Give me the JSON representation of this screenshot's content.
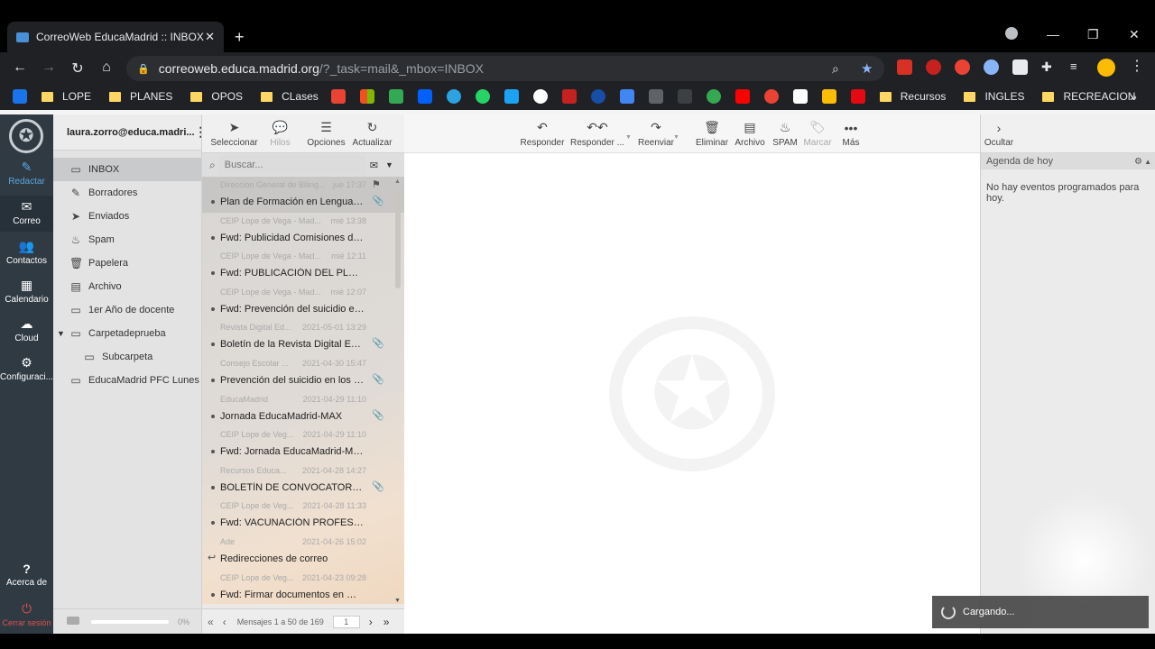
{
  "browser": {
    "tab_title": "CorreoWeb EducaMadrid :: INBOX",
    "url_host": "correoweb.educa.madrid.org",
    "url_path": "/?_task=mail&_mbox=INBOX",
    "bookmarks": [
      "LOPE",
      "PLANES",
      "OPOS",
      "CLases",
      "Recursos",
      "INGLES",
      "RECREACION"
    ],
    "more_bookmarks": "»"
  },
  "leftnav": {
    "compose": "Redactar",
    "mail": "Correo",
    "contacts": "Contactos",
    "calendar": "Calendario",
    "cloud": "Cloud",
    "settings": "Configuraci...",
    "about": "Acerca de",
    "logout": "Cerrar sesión"
  },
  "account": "laura.zorro@educa.madri...",
  "folders": [
    {
      "label": "INBOX",
      "icon": "inbox-icon"
    },
    {
      "label": "Borradores",
      "icon": "pencil-icon"
    },
    {
      "label": "Enviados",
      "icon": "send-icon"
    },
    {
      "label": "Spam",
      "icon": "fire-icon"
    },
    {
      "label": "Papelera",
      "icon": "trash-icon"
    },
    {
      "label": "Archivo",
      "icon": "archive-icon"
    },
    {
      "label": "1er Año de docente",
      "icon": "folder-icon"
    },
    {
      "label": "Carpetadeprueba",
      "icon": "folder-icon"
    },
    {
      "label": "Subcarpeta",
      "icon": "folder-icon"
    },
    {
      "label": "EducaMadrid PFC Lunes",
      "icon": "folder-icon"
    }
  ],
  "quota": "0%",
  "list_toolbar": {
    "select": "Seleccionar",
    "threads": "Hilos",
    "options": "Opciones",
    "refresh": "Actualizar"
  },
  "search_placeholder": "Buscar...",
  "messages": [
    {
      "from": "Dirección General de Biling...",
      "date": "jue 17:37",
      "subject": "Plan de Formación en Lenguas E...",
      "attach": true
    },
    {
      "from": "CEIP Lope de Vega - Mad...",
      "date": "mié 13:38",
      "subject": "Fwd: Publicidad Comisiones de ...",
      "attach": false
    },
    {
      "from": "CEIP Lope de Vega - Mad...",
      "date": "mié 12:11",
      "subject": "Fwd: PUBLICACIÓN DEL PLAN D...",
      "attach": false
    },
    {
      "from": "CEIP Lope de Vega - Mad...",
      "date": "mié 12:07",
      "subject": "Fwd: Prevención del suicidio en l...",
      "attach": false
    },
    {
      "from": "Revista Digital Ed...",
      "date": "2021-05-01 13:29",
      "subject": "Boletín de la Revista Digital Educ...",
      "attach": true
    },
    {
      "from": "Consejo Escolar ...",
      "date": "2021-04-30 15:47",
      "subject": "Prevención del suicidio en los ce...",
      "attach": true
    },
    {
      "from": "EducaMadrid",
      "date": "2021-04-29 11:10",
      "subject": "Jornada EducaMadrid-MAX",
      "attach": true
    },
    {
      "from": "CEIP Lope de Veg...",
      "date": "2021-04-29 11:10",
      "subject": "Fwd: Jornada EducaMadrid-MAX",
      "attach": false
    },
    {
      "from": "Recursos Educa...",
      "date": "2021-04-28 14:27",
      "subject": "BOLETÍN DE CONVOCATORIAS. ...",
      "attach": true
    },
    {
      "from": "CEIP Lope de Veg...",
      "date": "2021-04-28 11:33",
      "subject": "Fwd: VACUNACIÓN PROFESORA...",
      "attach": false
    },
    {
      "from": "Ade",
      "date": "2021-04-26 15:02",
      "subject": "Redirecciones de correo",
      "attach": false
    },
    {
      "from": "CEIP Lope de Veg...",
      "date": "2021-04-23 09:28",
      "subject": "Fwd: Firmar documentos en Max...",
      "attach": false
    }
  ],
  "pager": {
    "info": "Mensajes 1 a 50 de 169",
    "page": "1"
  },
  "preview_toolbar": {
    "reply": "Responder",
    "reply_all": "Responder ...",
    "forward": "Reenviar",
    "delete": "Eliminar",
    "archive": "Archivo",
    "spam": "SPAM",
    "mark": "Marcar",
    "more": "Más"
  },
  "agenda": {
    "hide": "Ocultar",
    "title": "Agenda de hoy",
    "empty": "No hay eventos programados para hoy."
  },
  "loading": "Cargando..."
}
